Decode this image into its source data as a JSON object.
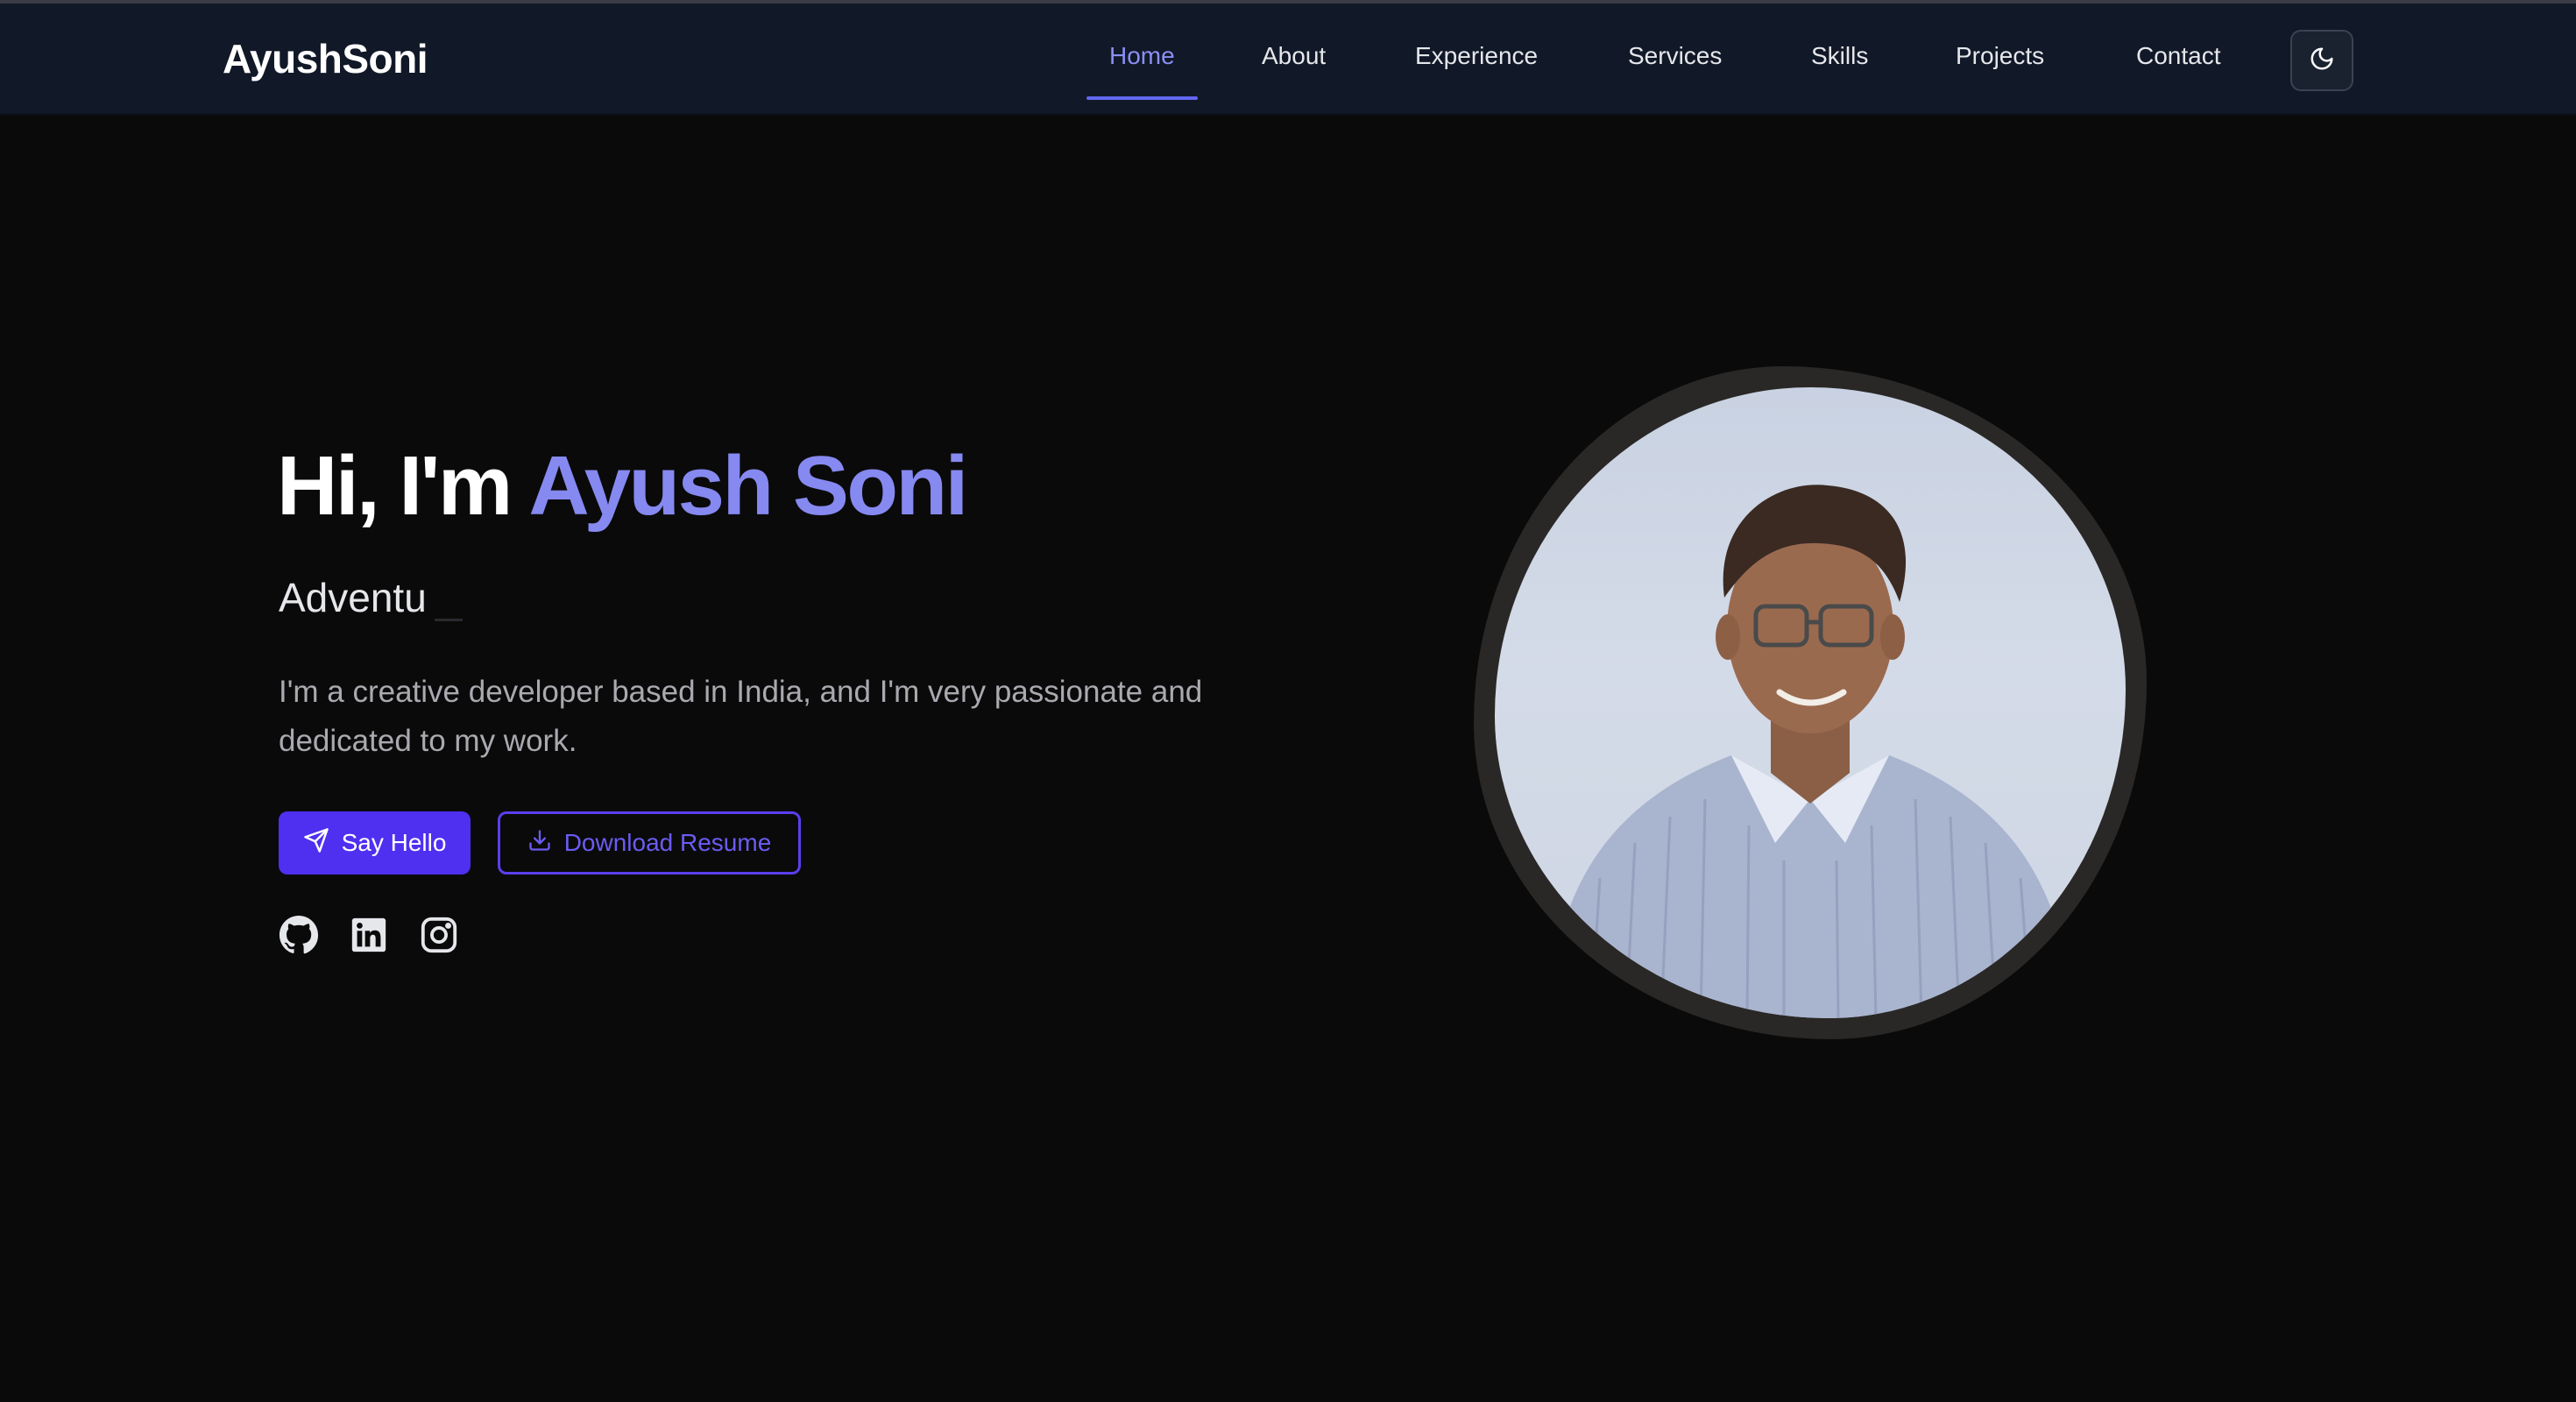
{
  "nav": {
    "brand": "AyushSoni",
    "items": [
      {
        "label": "Home",
        "active": true
      },
      {
        "label": "About"
      },
      {
        "label": "Experience"
      },
      {
        "label": "Services"
      },
      {
        "label": "Skills"
      },
      {
        "label": "Projects"
      },
      {
        "label": "Contact"
      }
    ],
    "theme_toggle_icon": "moon-icon"
  },
  "hero": {
    "greeting": "Hi, I'm ",
    "name": "Ayush Soni",
    "typed_text": "Adventu",
    "description": "I'm a creative developer based in India, and I'm very passionate and dedicated to my work.",
    "primary_button": {
      "label": "Say Hello",
      "icon": "send-icon"
    },
    "secondary_button": {
      "label": "Download Resume",
      "icon": "download-icon"
    },
    "socials": [
      {
        "icon": "github-icon"
      },
      {
        "icon": "linkedin-icon"
      },
      {
        "icon": "instagram-icon"
      }
    ]
  },
  "colors": {
    "accent": "#8589f0",
    "primary_button": "#4f2ff0",
    "background": "#0b0a0a",
    "navbar": "#111827"
  }
}
